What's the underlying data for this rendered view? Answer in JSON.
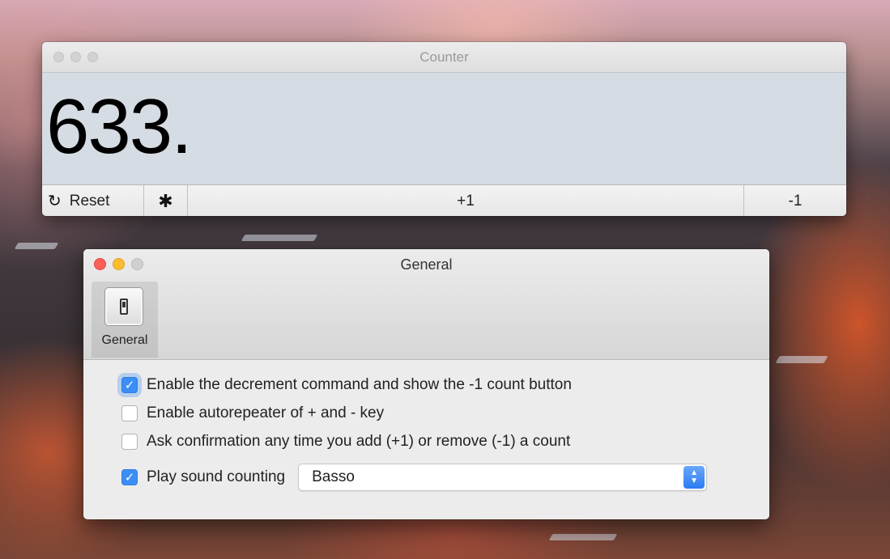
{
  "counter_window": {
    "title": "Counter",
    "count": "633.",
    "toolbar": {
      "reset_label": "Reset",
      "increment_label": "+1",
      "decrement_label": "-1"
    }
  },
  "general_window": {
    "title": "General",
    "tab_label": "General",
    "options": [
      {
        "label": "Enable the decrement command and show the -1 count button",
        "checked": true
      },
      {
        "label": "Enable autorepeater of + and - key",
        "checked": false
      },
      {
        "label": "Ask confirmation any time you add (+1) or remove (-1) a count",
        "checked": false
      },
      {
        "label": "Play sound counting",
        "checked": true
      }
    ],
    "sound_select": {
      "selected": "Basso"
    }
  },
  "icons": {
    "reset": "reset-icon",
    "gear": "gear-icon",
    "tab": "switch-icon",
    "checkmark": "✓"
  },
  "colors": {
    "accent": "#3b8ef5",
    "close": "#fc5f57",
    "minimize": "#fdbc2e"
  }
}
